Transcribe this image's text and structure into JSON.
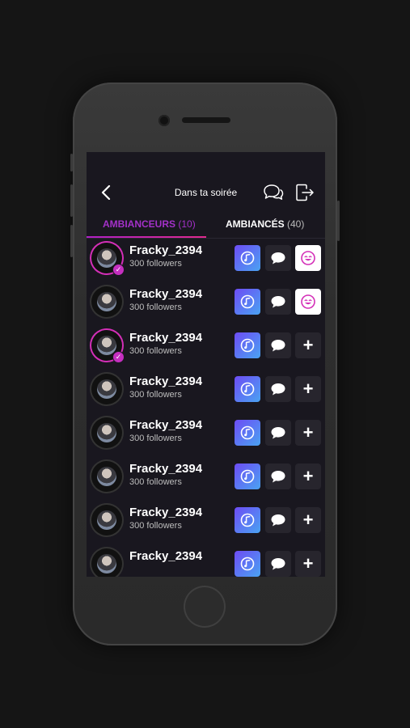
{
  "header": {
    "title": "Dans ta soirée"
  },
  "tabs": [
    {
      "label": "AMBIANCEURS",
      "count": "(10)"
    },
    {
      "label": "AMBIANCÉS",
      "count": "(40)"
    }
  ],
  "rows": [
    {
      "username": "Fracky_2394",
      "followers": "300 followers",
      "action": "smile-icon"
    },
    {
      "username": "Fracky_2394",
      "followers": "300 followers",
      "action": "smile-icon"
    },
    {
      "username": "Fracky_2394",
      "followers": "300 followers",
      "action": "plus-icon"
    },
    {
      "username": "Fracky_2394",
      "followers": "300 followers",
      "action": "plus-icon"
    },
    {
      "username": "Fracky_2394",
      "followers": "300 followers",
      "action": "plus-icon"
    },
    {
      "username": "Fracky_2394",
      "followers": "300 followers",
      "action": "plus-icon"
    },
    {
      "username": "Fracky_2394",
      "followers": "300 followers",
      "action": "plus-icon"
    },
    {
      "username": "Fracky_2394",
      "followers": "",
      "action": "plus-icon"
    }
  ],
  "icons": {
    "plus": "+"
  },
  "colors": {
    "accent": "#a431c9",
    "music_gradient_start": "#6d4cf5",
    "music_gradient_end": "#4aa3f2"
  }
}
